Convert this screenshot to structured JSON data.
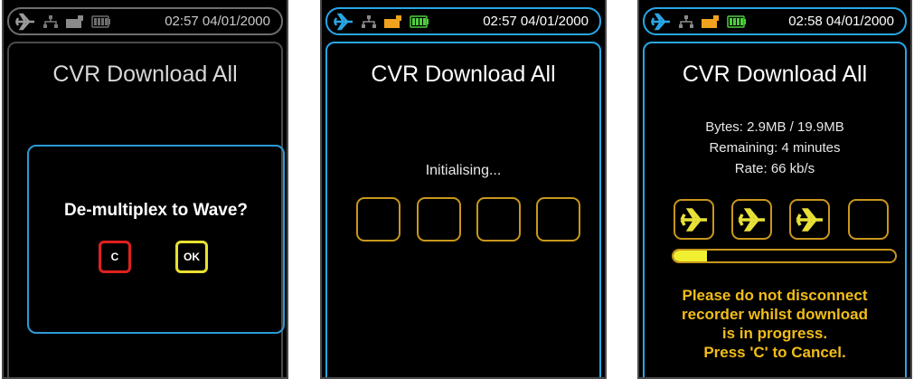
{
  "colors": {
    "accent_blue": "#29a6e6",
    "amber": "#f0b41e",
    "warning_text": "#f2bd1a",
    "cancel_red": "#e02020",
    "ok_yellow": "#e8e030",
    "progress_fill": "#f0f030"
  },
  "screens": [
    {
      "status": {
        "time": "02:57 04/01/2000",
        "icons": [
          "plane-icon",
          "network-icon",
          "usb-drive-icon",
          "battery-icon"
        ]
      },
      "title": "CVR Download All",
      "dialog": {
        "question": "De-multiplex to Wave?",
        "cancel_label": "C",
        "ok_label": "OK"
      }
    },
    {
      "status": {
        "time": "02:57 04/01/2000",
        "icons": [
          "plane-icon",
          "network-icon",
          "usb-drive-icon",
          "battery-icon"
        ]
      },
      "title": "CVR Download All",
      "message": "Initialising...",
      "slots_filled": 0,
      "slots_total": 4
    },
    {
      "status": {
        "time": "02:58 04/01/2000",
        "icons": [
          "plane-icon",
          "network-icon",
          "usb-drive-icon",
          "battery-icon"
        ]
      },
      "title": "CVR Download All",
      "bytes": "Bytes: 2.9MB / 19.9MB",
      "remaining": "Remaining: 4 minutes",
      "rate": "Rate: 66 kb/s",
      "slots_filled": 3,
      "slots_total": 4,
      "progress_fraction": 0.15,
      "warning": [
        "Please do not disconnect",
        "recorder whilst download",
        "is in progress.",
        "Press 'C' to Cancel."
      ]
    }
  ]
}
